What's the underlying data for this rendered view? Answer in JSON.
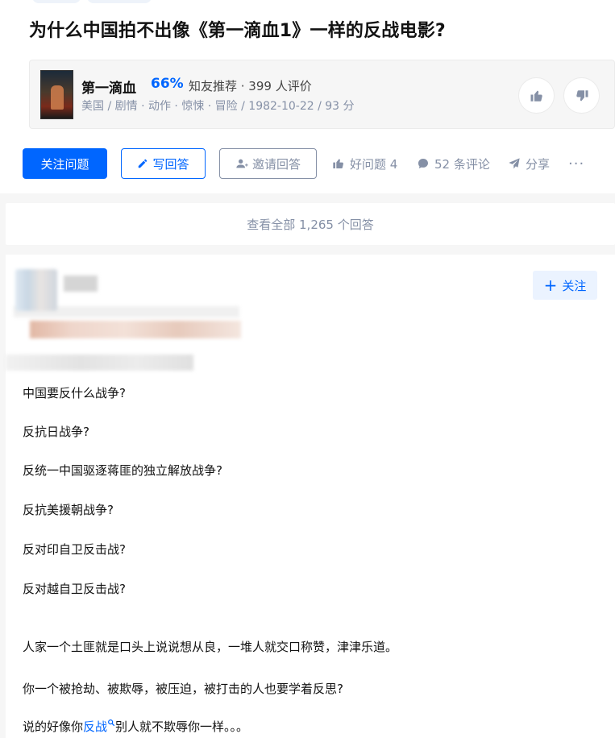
{
  "question": {
    "title": "为什么中国拍不出像《第一滴血1》一样的反战电影?"
  },
  "movie": {
    "name": "第一滴血",
    "rating": "66%",
    "recommend": "知友推荐 · 399 人评价",
    "meta": "美国 / 剧情 · 动作 · 惊悚 · 冒险 / 1982-10-22 / 93 分"
  },
  "actions": {
    "follow_label": "关注问题",
    "write_label": "写回答",
    "invite_label": "邀请回答",
    "good_label": "好问题 4",
    "comment_label": "52 条评论",
    "share_label": "分享",
    "more_label": "···"
  },
  "view_all": "查看全部 1,265 个回答",
  "answer": {
    "follow_label": "关注",
    "paragraphs": [
      "中国要反什么战争?",
      "反抗日战争?",
      "反统一中国驱逐蒋匪的独立解放战争?",
      "反抗美援朝战争?",
      "反对印自卫反击战?",
      "反对越自卫反击战?",
      "人家一个土匪就是口头上说说想从良，一堆人就交口称赞，津津乐道。",
      "你一个被抢劫、被欺辱，被压迫，被打击的人也要学着反思?"
    ],
    "last_pre": "说的好像你",
    "last_keyword": "反战",
    "last_post": "别人就不欺辱你一样。。。"
  },
  "colors": {
    "accent": "#0066ff",
    "muted": "#8590a6"
  }
}
